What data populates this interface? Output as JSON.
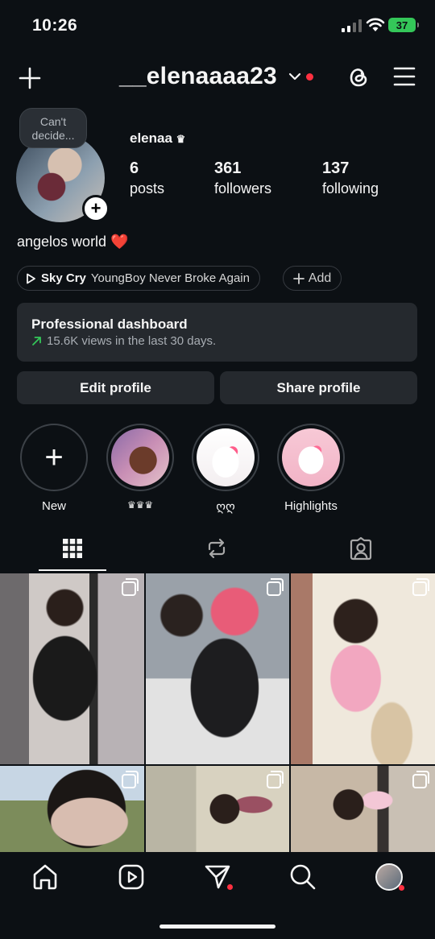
{
  "status_bar": {
    "time": "10:26",
    "battery": "37"
  },
  "header": {
    "username": "__elenaaaa23"
  },
  "profile": {
    "note": "Can't decide...",
    "display_name": "elenaa",
    "name_badge": "♛",
    "stats": [
      {
        "value": "6",
        "label": "posts"
      },
      {
        "value": "361",
        "label": "followers"
      },
      {
        "value": "137",
        "label": "following"
      }
    ],
    "bio": "angelos world",
    "bio_emoji": "❤️",
    "music": {
      "song": "Sky Cry",
      "artist": "YoungBoy Never Broke Again"
    },
    "add_label": "Add"
  },
  "dashboard": {
    "title": "Professional dashboard",
    "subtitle": "15.6K views in the last 30 days."
  },
  "buttons": {
    "edit": "Edit profile",
    "share": "Share profile"
  },
  "highlights": [
    {
      "label": "New"
    },
    {
      "label": "♛♛♛"
    },
    {
      "label": "ღღ"
    },
    {
      "label": "Highlights"
    }
  ],
  "colors": {
    "background": "#0c1014",
    "surface": "#25292e",
    "accent_red": "#ff3040",
    "trend_green": "#34c759"
  }
}
